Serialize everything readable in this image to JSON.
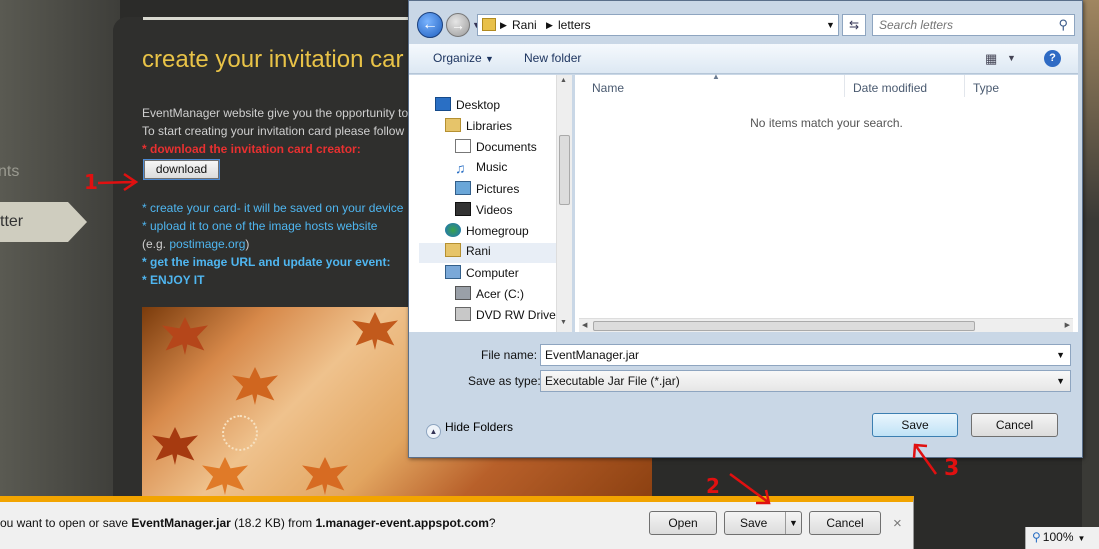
{
  "page": {
    "nav_partial_1": "nts",
    "nav_partial_2": "tter",
    "title": "create your invitation car",
    "intro_line1": "EventManager website give you the opportunity to",
    "intro_line2": "To start creating your invitation card please follow",
    "step_download": "* download the invitation card creator:",
    "download_button": "download",
    "step_create": "* create your card- it will be saved on your device",
    "step_upload": "* upload it to one of the image hosts website",
    "eg_prefix": "(e.g. ",
    "eg_link": "postimage.org",
    "eg_suffix": ")",
    "step_url": "* get the image URL and update your event:",
    "step_enjoy": "* ENJOY IT"
  },
  "dialog": {
    "breadcrumb": [
      "Rani",
      "letters"
    ],
    "search_placeholder": "Search letters",
    "toolbar": {
      "organize": "Organize",
      "new_folder": "New folder"
    },
    "tree": [
      {
        "label": "Desktop",
        "icon": "desktop-icon"
      },
      {
        "label": "Libraries",
        "icon": "libraries-icon"
      },
      {
        "label": "Documents",
        "icon": "documents-icon"
      },
      {
        "label": "Music",
        "icon": "music-icon"
      },
      {
        "label": "Pictures",
        "icon": "pictures-icon"
      },
      {
        "label": "Videos",
        "icon": "videos-icon"
      },
      {
        "label": "Homegroup",
        "icon": "homegroup-icon"
      },
      {
        "label": "Rani",
        "icon": "user-folder-icon"
      },
      {
        "label": "Computer",
        "icon": "computer-icon"
      },
      {
        "label": "Acer (C:)",
        "icon": "drive-icon"
      },
      {
        "label": "DVD RW Drive (",
        "icon": "dvd-drive-icon"
      }
    ],
    "columns": {
      "name": "Name",
      "date": "Date modified",
      "type": "Type"
    },
    "empty_message": "No items match your search.",
    "filename_label": "File name:",
    "filename_value": "EventManager.jar",
    "savetype_label": "Save as type:",
    "savetype_value": "Executable Jar File (*.jar)",
    "hide_folders": "Hide Folders",
    "save": "Save",
    "cancel": "Cancel"
  },
  "download_bar": {
    "msg_prefix": "ou want to open or save ",
    "filename": "EventManager.jar",
    "msg_mid": " (18.2 KB) from ",
    "host": "1.manager-event.appspot.com",
    "msg_suffix": "?",
    "open": "Open",
    "save": "Save",
    "cancel": "Cancel",
    "close": "×"
  },
  "status": {
    "zoom": "100%"
  },
  "annotations": {
    "a1": "1",
    "a2": "2",
    "a3": "3"
  },
  "colors": {
    "title": "#e9c347",
    "red": "#e83030",
    "blue": "#4fb6f0",
    "notify": "#f2a400"
  }
}
